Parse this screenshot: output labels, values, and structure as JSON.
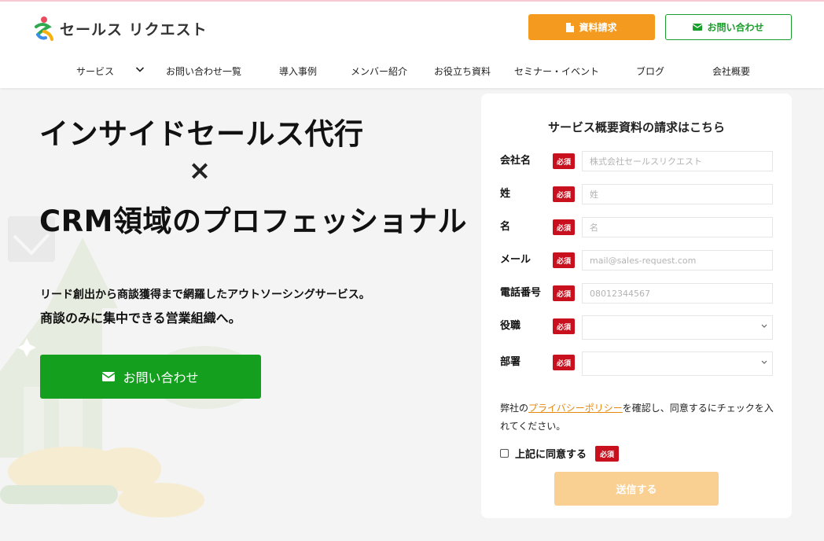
{
  "brand": {
    "name": "セールス リクエスト"
  },
  "header": {
    "doc_button": "資料請求",
    "contact_button": "お問い合わせ",
    "nav": [
      {
        "label": "サービス"
      },
      {
        "label": "お問い合わせ一覧"
      },
      {
        "label": "導入事例"
      },
      {
        "label": "メンバー紹介"
      },
      {
        "label": "お役立ち資料"
      },
      {
        "label": "セミナー・イベント"
      },
      {
        "label": "ブログ"
      },
      {
        "label": "会社概要"
      }
    ]
  },
  "hero": {
    "line1": "インサイドセールス代行",
    "times": "×",
    "line2": "CRM領域のプロフェッショナル",
    "sub1": "リード創出から商談獲得まで網羅したアウトソーシングサービス。",
    "sub2": "商談のみに集中できる営業組織へ。",
    "cta": "お問い合わせ"
  },
  "form": {
    "title": "サービス概要資料の請求はこちら",
    "required": "必須",
    "fields": [
      {
        "label": "会社名",
        "placeholder": "株式会社セールスリクエスト"
      },
      {
        "label": "姓",
        "placeholder": "姓"
      },
      {
        "label": "名",
        "placeholder": "名"
      },
      {
        "label": "メール",
        "placeholder": "mail@sales-request.com"
      },
      {
        "label": "電話番号",
        "placeholder": "08012344567"
      }
    ],
    "selects": [
      {
        "label": "役職"
      },
      {
        "label": "部署"
      }
    ],
    "privacy_prefix": "弊社の",
    "privacy_link": "プライバシーポリシー",
    "privacy_suffix": "を確認し、同意するにチェックを入れてください。",
    "agree_label": "上記に同意する",
    "submit": "送信する"
  },
  "colors": {
    "orange": "#f39a1f",
    "green": "#14a01e",
    "red": "#c8101e",
    "submit_disabled": "#f9cf92"
  }
}
